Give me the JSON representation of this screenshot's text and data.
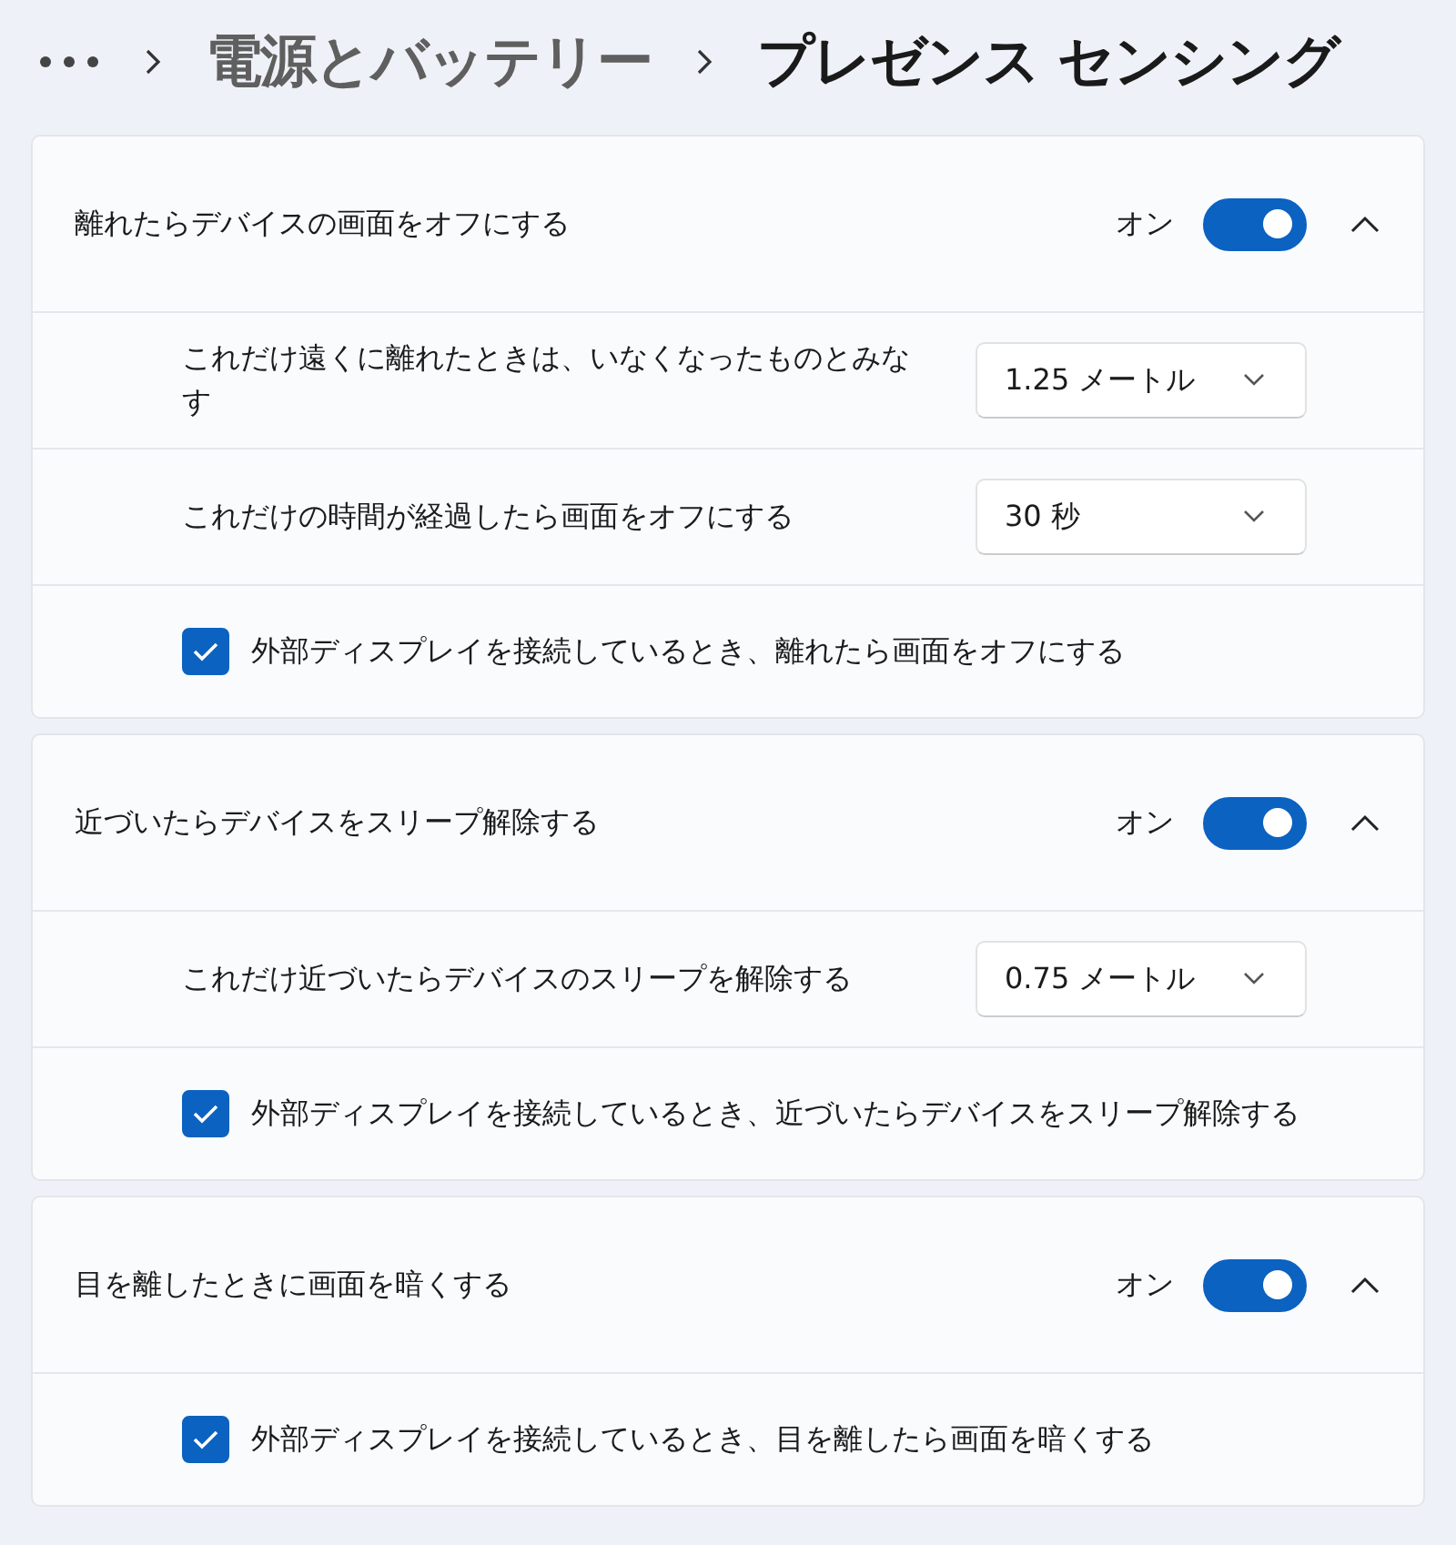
{
  "breadcrumb": [
    {
      "kind": "more"
    },
    {
      "kind": "parent",
      "text": "電源とバッテリー"
    },
    {
      "kind": "current",
      "text": "プレゼンス センシング"
    }
  ],
  "sections": [
    {
      "title": "離れたらデバイスの画面をオフにする",
      "toggle_label": "オン",
      "on": true,
      "expanded": true,
      "rows": [
        {
          "kind": "dropdown",
          "label": "これだけ遠くに離れたときは、いなくなったものとみなす",
          "value": "1.25 メートル"
        },
        {
          "kind": "dropdown",
          "label": "これだけの時間が経過したら画面をオフにする",
          "value": "30 秒"
        },
        {
          "kind": "checkbox",
          "label": "外部ディスプレイを接続しているとき、離れたら画面をオフにする",
          "checked": true
        }
      ]
    },
    {
      "title": "近づいたらデバイスをスリープ解除する",
      "toggle_label": "オン",
      "on": true,
      "expanded": true,
      "rows": [
        {
          "kind": "dropdown",
          "label": "これだけ近づいたらデバイスのスリープを解除する",
          "value": "0.75 メートル"
        },
        {
          "kind": "checkbox",
          "label": "外部ディスプレイを接続しているとき、近づいたらデバイスをスリープ解除する",
          "checked": true
        }
      ]
    },
    {
      "title": "目を離したときに画面を暗くする",
      "toggle_label": "オン",
      "on": true,
      "expanded": true,
      "rows": [
        {
          "kind": "checkbox",
          "label": "外部ディスプレイを接続しているとき、目を離したら画面を暗くする",
          "checked": true
        }
      ]
    }
  ]
}
